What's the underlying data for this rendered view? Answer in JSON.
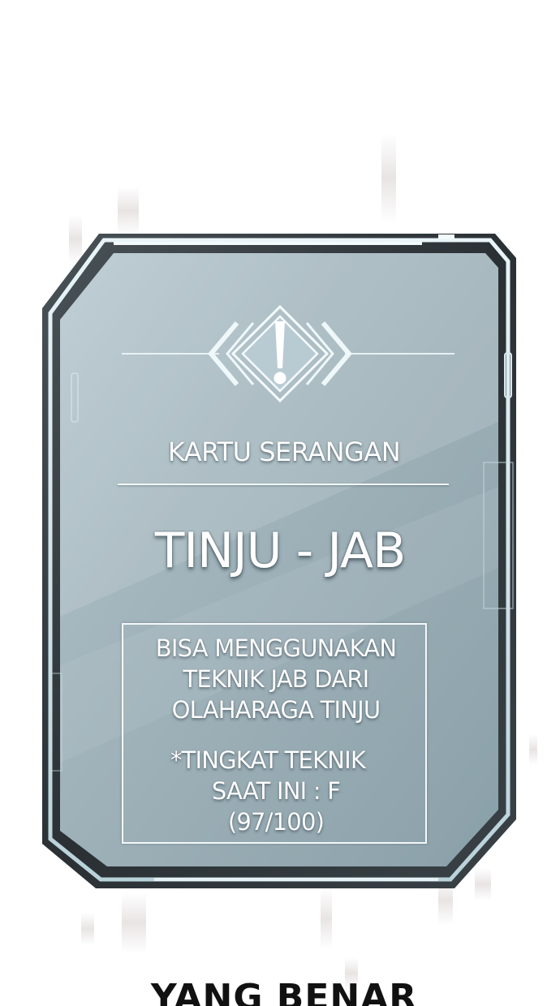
{
  "card": {
    "type_label": "KARTU SERANGAN",
    "name": "TINJU - JAB",
    "description": [
      "BISA MENGGUNAKAN",
      "TEKNIK JAB DARI",
      "OLAHARAGA TINJU"
    ],
    "level_lines": [
      "*TINGKAT TEKNIK",
      "SAAT INI : F",
      "(97/100)"
    ],
    "alert_icon": "warning-exclamation-icon"
  },
  "caption": {
    "text": "YANG BENAR"
  },
  "colors": {
    "frame_dark": "#2e3438",
    "frame_light": "#cfe3ea",
    "panel": "#9fb3bb",
    "text": "#ffffff",
    "caption_text": "#111111"
  }
}
